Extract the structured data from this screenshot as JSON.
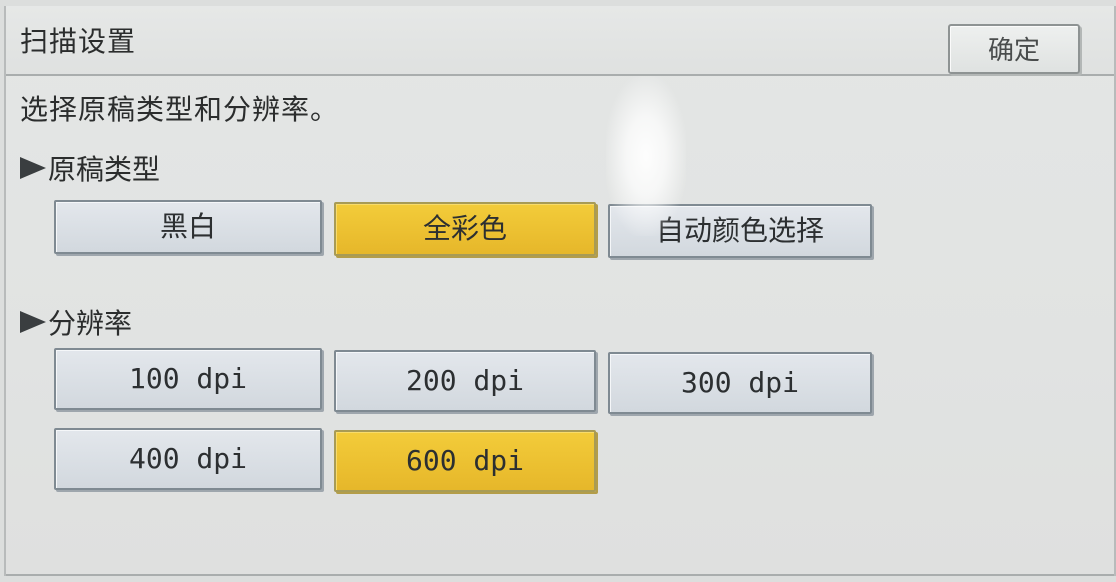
{
  "header": {
    "title": "扫描设置",
    "ok_label": "确定"
  },
  "instruction": "选择原稿类型和分辨率。",
  "original_type": {
    "heading": "原稿类型",
    "options": [
      {
        "label": "黑白",
        "selected": false
      },
      {
        "label": "全彩色",
        "selected": true
      },
      {
        "label": "自动颜色选择",
        "selected": false
      }
    ]
  },
  "resolution": {
    "heading": "分辨率",
    "options": [
      {
        "label": "100 dpi",
        "selected": false
      },
      {
        "label": "200 dpi",
        "selected": false
      },
      {
        "label": "300 dpi",
        "selected": false
      },
      {
        "label": "400 dpi",
        "selected": false
      },
      {
        "label": "600 dpi",
        "selected": true
      }
    ]
  },
  "colors": {
    "selected": "#f0c636",
    "button": "#d8dde3",
    "background": "#e1e3e2"
  }
}
